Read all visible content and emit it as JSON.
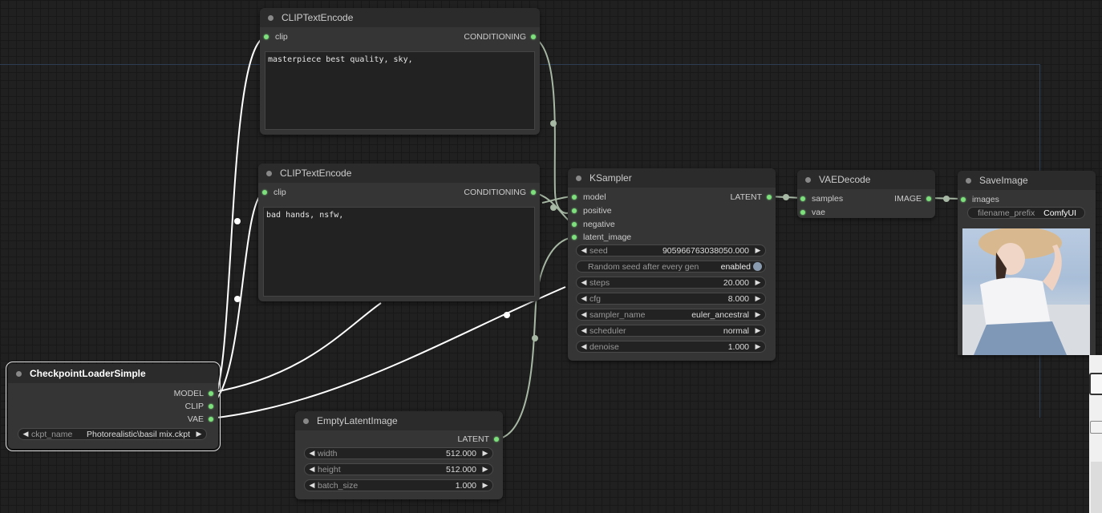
{
  "nodes": {
    "clip_pos": {
      "title": "CLIPTextEncode",
      "input": "clip",
      "output": "CONDITIONING",
      "text": "masterpiece best quality, sky,"
    },
    "clip_neg": {
      "title": "CLIPTextEncode",
      "input": "clip",
      "output": "CONDITIONING",
      "text": "bad hands, nsfw,"
    },
    "ksampler": {
      "title": "KSampler",
      "inputs": [
        "model",
        "positive",
        "negative",
        "latent_image"
      ],
      "output": "LATENT",
      "widgets": {
        "seed": {
          "label": "seed",
          "value": "905966763038050.000"
        },
        "random_seed": {
          "label": "Random seed after every gen",
          "value": "enabled"
        },
        "steps": {
          "label": "steps",
          "value": "20.000"
        },
        "cfg": {
          "label": "cfg",
          "value": "8.000"
        },
        "sampler_name": {
          "label": "sampler_name",
          "value": "euler_ancestral"
        },
        "scheduler": {
          "label": "scheduler",
          "value": "normal"
        },
        "denoise": {
          "label": "denoise",
          "value": "1.000"
        }
      }
    },
    "vaedecode": {
      "title": "VAEDecode",
      "inputs": [
        "samples",
        "vae"
      ],
      "output": "IMAGE"
    },
    "saveimage": {
      "title": "SaveImage",
      "input": "images",
      "filename_prefix": {
        "label": "filename_prefix",
        "value": "ComfyUI"
      }
    },
    "checkpoint": {
      "title": "CheckpointLoaderSimple",
      "outputs": [
        "MODEL",
        "CLIP",
        "VAE"
      ],
      "ckpt_name": {
        "label": "ckpt_name",
        "value": "Photorealistic\\basil mix.ckpt"
      }
    },
    "latent": {
      "title": "EmptyLatentImage",
      "output": "LATENT",
      "widgets": {
        "width": {
          "label": "width",
          "value": "512.000"
        },
        "height": {
          "label": "height",
          "value": "512.000"
        },
        "batch_size": {
          "label": "batch_size",
          "value": "1.000"
        }
      }
    }
  },
  "colors": {
    "canvas": "#202020",
    "node_body": "#353535",
    "node_title": "#2b2b2b",
    "pin": "#7de07d",
    "link_white": "#ffffff",
    "link_green": "#a7b8a4"
  }
}
